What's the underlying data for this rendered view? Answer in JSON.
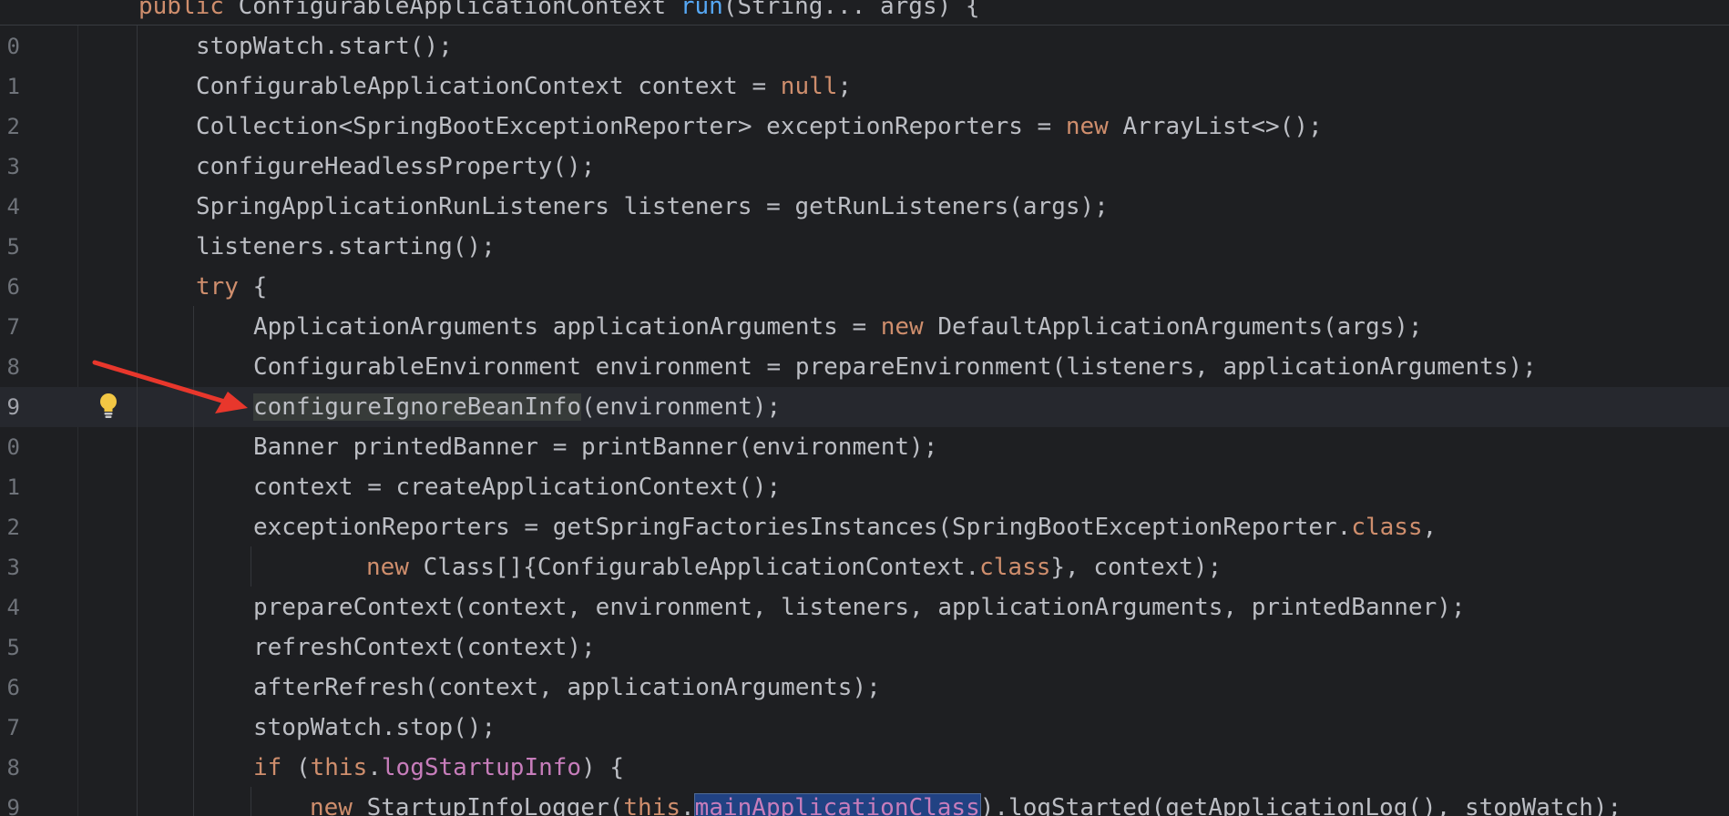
{
  "sticky_header": {
    "text_kw": "public",
    "text_type": " ConfigurableApplicationContext ",
    "text_fn": "run",
    "text_rest": "(String... args) {"
  },
  "lines": [
    {
      "num": "0",
      "parts": [
        [
          "stopWatch.start();",
          "plain"
        ]
      ]
    },
    {
      "num": "1",
      "parts": [
        [
          "ConfigurableApplicationContext context = ",
          "plain"
        ],
        [
          "null",
          "kw"
        ],
        [
          ";",
          "plain"
        ]
      ]
    },
    {
      "num": "2",
      "parts": [
        [
          "Collection<SpringBootExceptionReporter> exceptionReporters = ",
          "plain"
        ],
        [
          "new",
          "kw"
        ],
        [
          " ArrayList<>();",
          "plain"
        ]
      ]
    },
    {
      "num": "3",
      "parts": [
        [
          "configureHeadlessProperty();",
          "plain"
        ]
      ]
    },
    {
      "num": "4",
      "parts": [
        [
          "SpringApplicationRunListeners listeners = getRunListeners(args);",
          "plain"
        ]
      ]
    },
    {
      "num": "5",
      "parts": [
        [
          "listeners.starting();",
          "plain"
        ]
      ]
    },
    {
      "num": "6",
      "parts": [
        [
          "try",
          "kw"
        ],
        [
          " {",
          "plain"
        ]
      ]
    },
    {
      "num": "7",
      "parts": [
        [
          "ApplicationArguments applicationArguments = ",
          "plain"
        ],
        [
          "new",
          "kw"
        ],
        [
          " DefaultApplicationArguments(args);",
          "plain"
        ]
      ]
    },
    {
      "num": "8",
      "parts": [
        [
          "ConfigurableEnvironment environment = prepareEnvironment(listeners, applicationArguments);",
          "plain"
        ]
      ]
    },
    {
      "num": "9",
      "parts": [
        [
          "configureIgnoreBeanInfo",
          "hl-word"
        ],
        [
          "(environment);",
          "plain"
        ]
      ]
    },
    {
      "num": "0",
      "parts": [
        [
          "Banner printedBanner = printBanner(environment);",
          "plain"
        ]
      ]
    },
    {
      "num": "1",
      "parts": [
        [
          "context = createApplicationContext();",
          "plain"
        ]
      ]
    },
    {
      "num": "2",
      "parts": [
        [
          "exceptionReporters = getSpringFactoriesInstances(SpringBootExceptionReporter.",
          "plain"
        ],
        [
          "class",
          "kw"
        ],
        [
          ",",
          "plain"
        ]
      ]
    },
    {
      "num": "3",
      "parts": [
        [
          "new",
          "kw"
        ],
        [
          " Class[]{ConfigurableApplicationContext.",
          "plain"
        ],
        [
          "class",
          "kw"
        ],
        [
          "}, context);",
          "plain"
        ]
      ]
    },
    {
      "num": "4",
      "parts": [
        [
          "prepareContext(context, environment, listeners, applicationArguments, printedBanner);",
          "plain"
        ]
      ]
    },
    {
      "num": "5",
      "parts": [
        [
          "refreshContext(context);",
          "plain"
        ]
      ]
    },
    {
      "num": "6",
      "parts": [
        [
          "afterRefresh(context, applicationArguments);",
          "plain"
        ]
      ]
    },
    {
      "num": "7",
      "parts": [
        [
          "stopWatch.stop();",
          "plain"
        ]
      ]
    },
    {
      "num": "8",
      "parts": [
        [
          "if",
          "kw"
        ],
        [
          " (",
          "plain"
        ],
        [
          "this",
          "kw"
        ],
        [
          ".",
          "plain"
        ],
        [
          "logStartupInfo",
          "field"
        ],
        [
          ") {",
          "plain"
        ]
      ]
    },
    {
      "num": "9",
      "parts": [
        [
          "new",
          "kw"
        ],
        [
          " StartupInfoLogger(",
          "plain"
        ],
        [
          "this",
          "kw"
        ],
        [
          ".",
          "plain"
        ],
        [
          "mainApplicationClass",
          "field sel-word"
        ],
        [
          ").logStarted(getApplicationLog(), stopWatch);",
          "plain"
        ]
      ]
    }
  ],
  "indents": [
    215,
    215,
    215,
    215,
    215,
    215,
    215,
    278,
    278,
    278,
    278,
    278,
    278,
    402,
    278,
    278,
    278,
    278,
    278,
    340
  ],
  "current_line_index": 9,
  "gutter_icon": "lightbulb-icon",
  "annotation_icon": "red-arrow-icon",
  "colors": {
    "background": "#1e1f22",
    "keyword": "#cf8e6d",
    "function": "#56a8f5",
    "field": "#c77dbb",
    "text": "#bcbec4",
    "arrow": "#e8372c",
    "bulb": "#f2c744"
  }
}
